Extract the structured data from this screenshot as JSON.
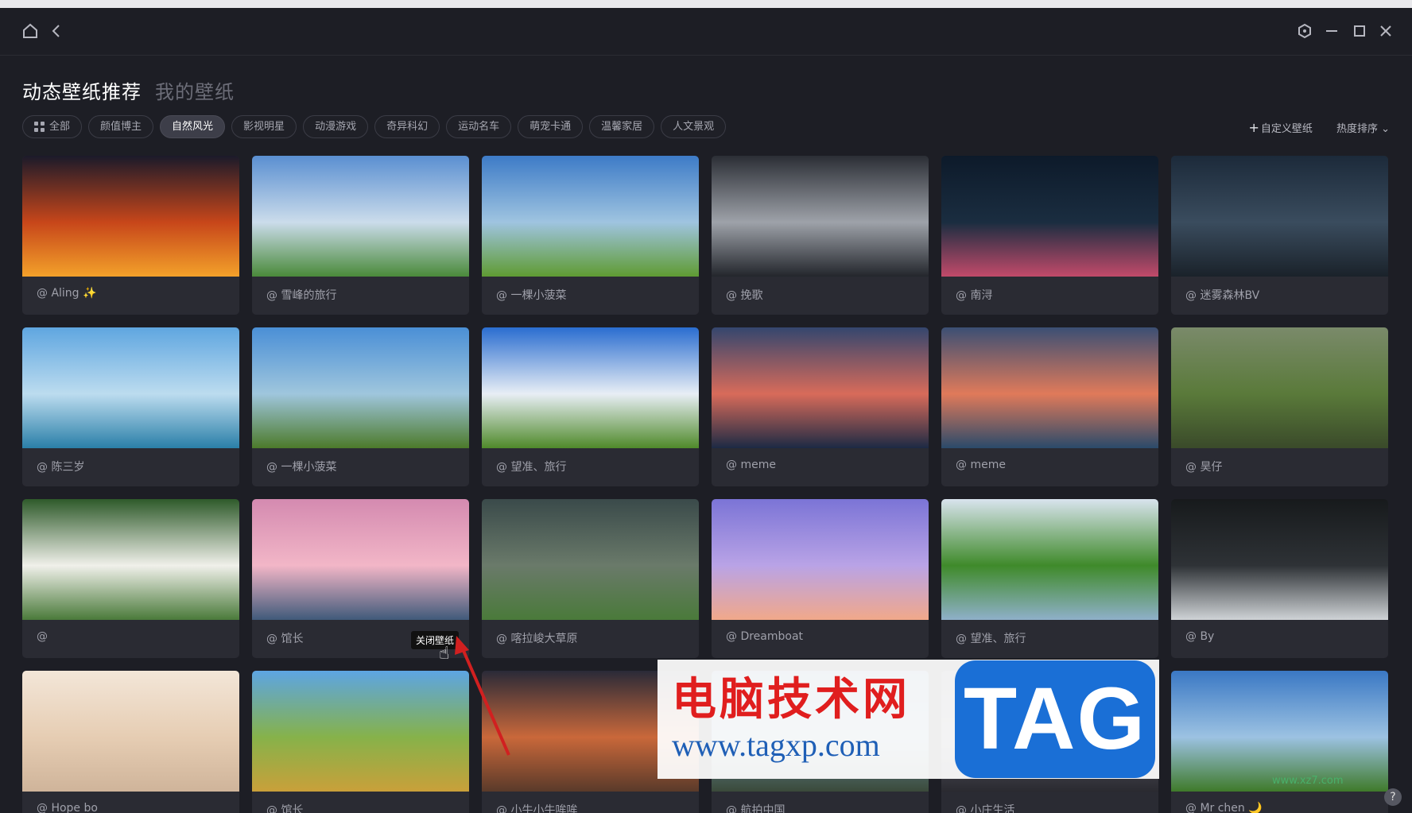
{
  "window": {
    "controls": [
      "home-icon",
      "back-icon",
      "settings-icon",
      "minimize-icon",
      "maximize-icon",
      "close-icon"
    ]
  },
  "tabs": {
    "active": "动态壁纸推荐",
    "inactive": "我的壁纸"
  },
  "filters": [
    {
      "label": "全部",
      "selected": false
    },
    {
      "label": "颜值博主",
      "selected": false
    },
    {
      "label": "自然风光",
      "selected": true
    },
    {
      "label": "影视明星",
      "selected": false
    },
    {
      "label": "动漫游戏",
      "selected": false
    },
    {
      "label": "奇异科幻",
      "selected": false
    },
    {
      "label": "运动名车",
      "selected": false
    },
    {
      "label": "萌宠卡通",
      "selected": false
    },
    {
      "label": "温馨家居",
      "selected": false
    },
    {
      "label": "人文景观",
      "selected": false
    }
  ],
  "toolbar": {
    "custom": "自定义壁纸",
    "sort": "热度排序"
  },
  "cards": [
    {
      "author": "@ Aling ✨",
      "colors": [
        "#1b1a2a",
        "#c7461a",
        "#f3a12a"
      ]
    },
    {
      "author": "@ 雪峰的旅行",
      "colors": [
        "#5a8fd1",
        "#cbdceb",
        "#4a8a3a"
      ]
    },
    {
      "author": "@ 一棵小菠菜",
      "colors": [
        "#3d7bc7",
        "#9fc4e0",
        "#5f9b32"
      ]
    },
    {
      "author": "@ 挽歌",
      "colors": [
        "#2b2e35",
        "#9ea2a9",
        "#23262c"
      ]
    },
    {
      "author": "@ 南浔",
      "colors": [
        "#0d1a2a",
        "#1a2d40",
        "#c24a6a"
      ]
    },
    {
      "author": "@ 迷雾森林BV",
      "colors": [
        "#1c2a3a",
        "#3a4c5e",
        "#1a222a"
      ]
    },
    {
      "author": "@ 陈三岁",
      "colors": [
        "#5fa6e0",
        "#bcdcef",
        "#2a7fa8"
      ]
    },
    {
      "author": "@ 一棵小菠菜",
      "colors": [
        "#4a8fd6",
        "#9fc6dd",
        "#4c7a2a"
      ]
    },
    {
      "author": "@ 望准、旅行",
      "colors": [
        "#2a6dd0",
        "#e8eef5",
        "#4f8a2a"
      ]
    },
    {
      "author": "@ meme",
      "colors": [
        "#34466e",
        "#d86b5a",
        "#1c2a44"
      ]
    },
    {
      "author": "@ meme",
      "colors": [
        "#3b4f74",
        "#e07a5a",
        "#2a4a6a"
      ]
    },
    {
      "author": "@ 昊仔",
      "colors": [
        "#7a8a6a",
        "#5a7a3a",
        "#3a4a2a"
      ]
    },
    {
      "author": "@",
      "colors": [
        "#2e5a2a",
        "#f0f0ea",
        "#4a7a3a"
      ]
    },
    {
      "author": "@ 馆长",
      "colors": [
        "#d48ab0",
        "#f2b6c7",
        "#405a7a"
      ]
    },
    {
      "author": "@ 喀拉峻大草原",
      "colors": [
        "#3a4a4a",
        "#6a7a6a",
        "#4a7a3a"
      ]
    },
    {
      "author": "@ Dreamboat",
      "colors": [
        "#7b74d6",
        "#b9a3e6",
        "#f1a88a"
      ]
    },
    {
      "author": "@ 望准、旅行",
      "colors": [
        "#d9e4ee",
        "#3f8a2a",
        "#8fb0c9"
      ]
    },
    {
      "author": "@ By",
      "colors": [
        "#171a1c",
        "#2e3236",
        "#cfd3d6"
      ]
    },
    {
      "author": "@ Hope bo",
      "colors": [
        "#f3e6d8",
        "#e6cdb3",
        "#cfb49a"
      ]
    },
    {
      "author": "@ 馆长",
      "colors": [
        "#5da5e3",
        "#86b24a",
        "#c9a03a"
      ]
    },
    {
      "author": "@ 小牛小牛哞哞",
      "colors": [
        "#2a2a38",
        "#c9683a",
        "#5a3a2a"
      ]
    },
    {
      "author": "@ 航拍中国",
      "colors": [
        "#4c6a8a",
        "#6a8aa0",
        "#3a4a3a"
      ]
    },
    {
      "author": "@ 小庄生活",
      "colors": [
        "#3a3a44",
        "#5a5a66",
        "#2a2a30"
      ]
    },
    {
      "author": "@ Mr chen 🌙",
      "colors": [
        "#3a78c4",
        "#9cc2e2",
        "#3f7a2a"
      ]
    }
  ],
  "tooltip": "关闭壁纸",
  "watermark": {
    "cn": "电脑技术网",
    "url": "www.tagxp.com",
    "tag": "TAG"
  },
  "site_watermark": "www.xz7.com",
  "help_icon": "?"
}
